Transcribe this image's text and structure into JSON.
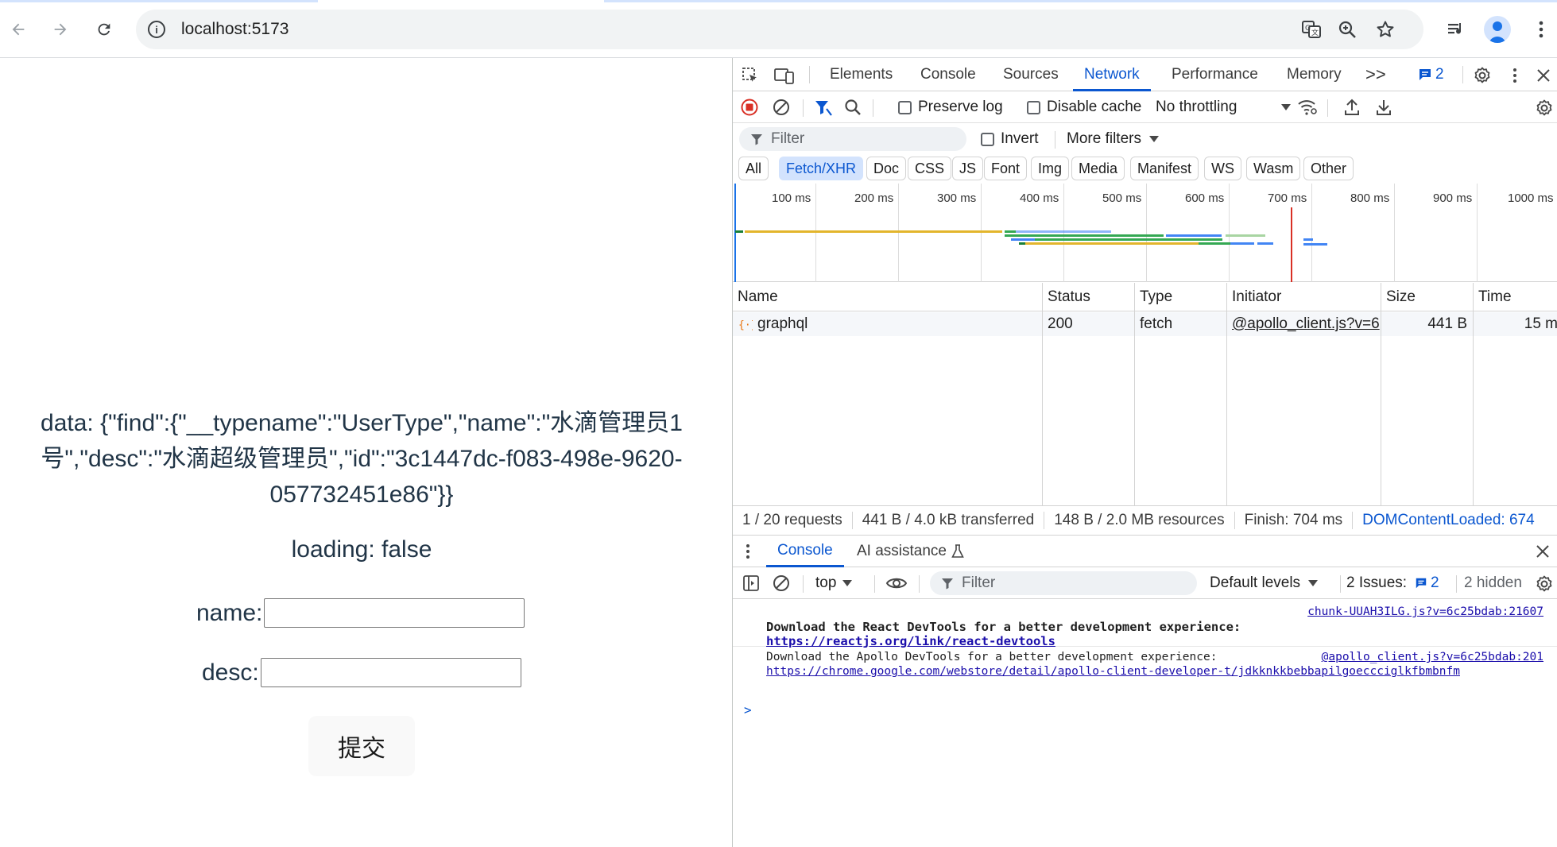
{
  "browser": {
    "url": "localhost:5173",
    "icons": {
      "back": "arrow-left-icon",
      "forward": "arrow-right-icon",
      "reload": "reload-icon",
      "site_info": "info-icon",
      "translate": "translate-icon",
      "zoom": "zoom-icon",
      "bookmark": "star-icon",
      "media": "media-control-icon",
      "profile": "profile-avatar",
      "menu": "kebab-menu-icon"
    }
  },
  "page": {
    "data_text": "data: {\"find\":{\"__typename\":\"UserType\",\"name\":\"水滴管理员1号\",\"desc\":\"水滴超级管理员\",\"id\":\"3c1447dc-f083-498e-9620-057732451e86\"}}",
    "loading_text": "loading: false",
    "name_label": "name:",
    "name_value": "",
    "desc_label": "desc:",
    "desc_value": "",
    "submit_label": "提交"
  },
  "devtools": {
    "tabs": [
      "Elements",
      "Console",
      "Sources",
      "Network",
      "Performance",
      "Memory"
    ],
    "active_tab": "Network",
    "more_tabs": ">>",
    "issues_count": "2",
    "network_toolbar": {
      "preserve_log": "Preserve log",
      "disable_cache": "Disable cache",
      "throttling": "No throttling"
    },
    "filter_bar": {
      "placeholder": "Filter",
      "invert": "Invert",
      "more_filters": "More filters"
    },
    "type_filters": [
      "All",
      "Fetch/XHR",
      "Doc",
      "CSS",
      "JS",
      "Font",
      "Img",
      "Media",
      "Manifest",
      "WS",
      "Wasm",
      "Other"
    ],
    "active_type": "Fetch/XHR",
    "overview_ticks": [
      "100 ms",
      "200 ms",
      "300 ms",
      "400 ms",
      "500 ms",
      "600 ms",
      "700 ms",
      "800 ms",
      "900 ms",
      "1000 ms"
    ],
    "table": {
      "columns": [
        "Name",
        "Status",
        "Type",
        "Initiator",
        "Size",
        "Time"
      ],
      "rows": [
        {
          "name": "graphql",
          "status": "200",
          "type": "fetch",
          "initiator": "@apollo_client.js?v=6",
          "size": "441 B",
          "time": "15 m"
        }
      ]
    },
    "summary": {
      "requests": "1 / 20 requests",
      "transferred": "441 B / 4.0 kB transferred",
      "resources": "148 B / 2.0 MB resources",
      "finish": "Finish: 704 ms",
      "dcl": "DOMContentLoaded: 674"
    },
    "drawer": {
      "tabs": [
        "Console",
        "AI assistance"
      ],
      "active_tab": "Console",
      "context": "top",
      "filter_placeholder": "Filter",
      "levels": "Default levels",
      "issues_label": "2 Issues:",
      "issues_count": "2",
      "hidden": "2 hidden",
      "messages": [
        {
          "source": "chunk-UUAH3ILG.js?v=6c25bdab:21607",
          "text": "Download the React DevTools for a better development experience:",
          "link": "https://reactjs.org/link/react-devtools",
          "bold": true
        },
        {
          "source": "@apollo_client.js?v=6c25bdab:201",
          "text": "Download the Apollo DevTools for a better development experience:",
          "link": "https://chrome.google.com/webstore/detail/apollo-client-developer-t/jdkknkkbebbapilgoeccciglkfbmbnfm",
          "bold": false
        }
      ],
      "prompt": ">"
    },
    "colors": {
      "accent": "#0b57d0",
      "record_red": "#d93025",
      "ov_yellow": "#e3b52c",
      "ov_green": "#34a853",
      "ov_blue": "#4285f4",
      "ov_red_line": "#d93025"
    }
  }
}
